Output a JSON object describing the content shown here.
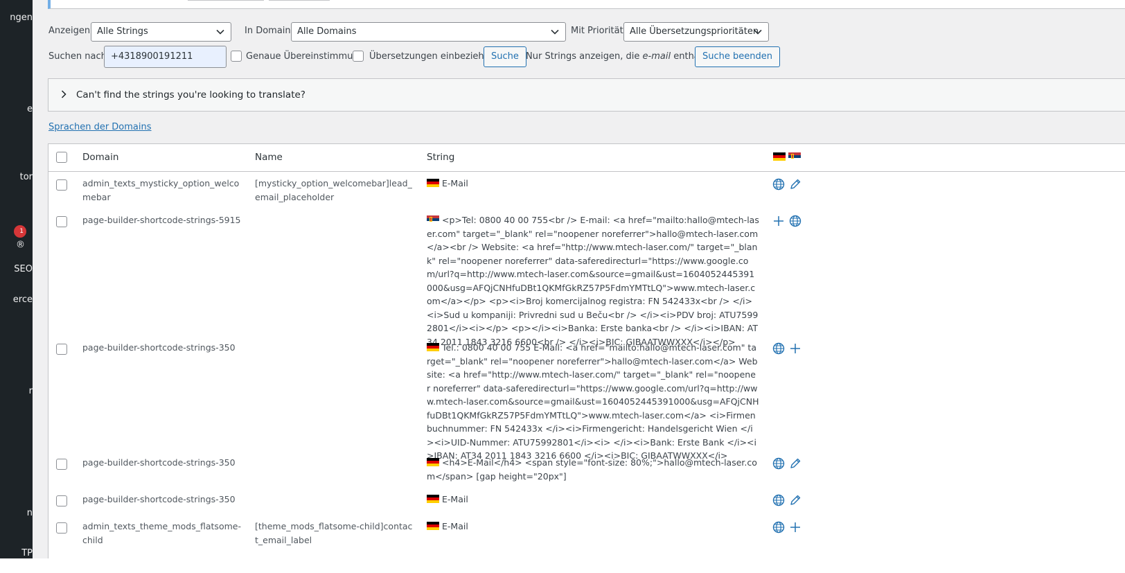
{
  "sidebar": {
    "items": [
      {
        "label": "ngen"
      },
      {
        "label": "e"
      },
      {
        "label": "tor"
      },
      {
        "label": "1"
      },
      {
        "label": "®"
      },
      {
        "label": "SEO"
      },
      {
        "label": "erce"
      },
      {
        "label": "r"
      },
      {
        "label": "n"
      },
      {
        "label": "TP"
      }
    ]
  },
  "filters": {
    "show_label": "Anzeigen:",
    "show_value": "Alle Strings",
    "domain_label": "In Domain:",
    "domain_value": "Alle Domains",
    "priority_label": "Mit Priorität:",
    "priority_value": "Alle Übersetzungsprioritäten",
    "search_label": "Suchen nach:",
    "search_value": "+4318900191211",
    "exact_match_label": "Genaue Übereinstimmung",
    "include_translations_label": "Übersetzungen einbeziehen",
    "search_button": "Suche",
    "filter_text_prefix": "Nur Strings anzeigen, die",
    "filter_text_term": "e-mail",
    "filter_text_suffix": "enthalten",
    "end_search_button": "Suche beenden"
  },
  "notice": {
    "text": "Can't find the strings you're looking to translate?"
  },
  "domain_languages_link": "Sprachen der Domains",
  "table": {
    "headers": {
      "domain": "Domain",
      "name": "Name",
      "string": "String"
    },
    "rows": [
      {
        "domain": "admin_texts_mysticky_option_welcomebar",
        "name": "[mysticky_option_welcomebar]lead_email_placeholder",
        "flag": "de",
        "string": "E-Mail",
        "actions": [
          "globe-icon",
          "pencil-icon"
        ]
      },
      {
        "domain": "page-builder-shortcode-strings-5915",
        "name": "",
        "flag": "rs",
        "string": "<p>Tel: 0800 40 00 755<br /> E-mail: <a href=\"mailto:hallo@mtech-laser.com\" target=\"_blank\" rel=\"noopener noreferrer\">hallo@mtech-laser.com</a><br /> Website: <a href=\"http://www.mtech-laser.com/\" target=\"_blank\" rel=\"noopener noreferrer\" data-saferedirecturl=\"https://www.google.com/url?q=http://www.mtech-laser.com&source=gmail&ust=1604052445391000&usg=AFQjCNHfuDBt1QKMfGkRZ57P5FdmYMTtLQ\">www.mtech-laser.com</a></p> <p><i>Broj komercijalnog registra: FN 542433x<br /> </i><i>Sud u kompaniji: Privredni sud u Beču<br /> </i><i>PDV broj: ATU75992801</i><i></p> <p></i><i>Banka: Erste banka<br /> </i><i>IBAN: AT34 2011 1843 3216 6600<br /> </i><i>BIC: GIBAATWWXXX</i></p>",
        "actions": [
          "plus-icon",
          "globe-icon"
        ]
      },
      {
        "domain": "page-builder-shortcode-strings-350",
        "name": "",
        "flag": "de",
        "string": "Tel.: 0800 40 00 755 E-Mail: <a href=\"mailto:hallo@mtech-laser.com\" target=\"_blank\" rel=\"noopener noreferrer\">hallo@mtech-laser.com</a> Website: <a href=\"http://www.mtech-laser.com/\" target=\"_blank\" rel=\"noopener noreferrer\" data-saferedirecturl=\"https://www.google.com/url?q=http://www.mtech-laser.com&source=gmail&ust=1604052445391000&usg=AFQjCNHfuDBt1QKMfGkRZ57P5FdmYMTtLQ\">www.mtech-laser.com</a> <i>Firmenbuchnummer: FN 542433x </i><i>Firmengericht: Handelsgericht Wien </i><i>UID-Nummer: ATU75992801</i><i> </i><i>Bank: Erste Bank </i><i>IBAN: AT34 2011 1843 3216 6600 </i><i>BIC: GIBAATWWXXX</i>",
        "actions": [
          "globe-icon",
          "plus-icon"
        ]
      },
      {
        "domain": "page-builder-shortcode-strings-350",
        "name": "",
        "flag": "de",
        "string": "<h4>E-Mail</h4> <span style=\"font-size: 80%;\">hallo@mtech-laser.com</span> [gap height=\"20px\"]",
        "actions": [
          "globe-icon",
          "pencil-icon"
        ]
      },
      {
        "domain": "page-builder-shortcode-strings-350",
        "name": "",
        "flag": "de",
        "string": "E-Mail",
        "actions": [
          "globe-icon",
          "pencil-icon"
        ]
      },
      {
        "domain": "admin_texts_theme_mods_flatsome-child",
        "name": "[theme_mods_flatsome-child]contact_email_label",
        "flag": "de",
        "string": "E-Mail",
        "actions": [
          "globe-icon",
          "plus-icon"
        ]
      }
    ]
  },
  "colors": {
    "sidebar_bg": "#1d2327",
    "accent": "#2271b1",
    "badge": "#d63638"
  }
}
